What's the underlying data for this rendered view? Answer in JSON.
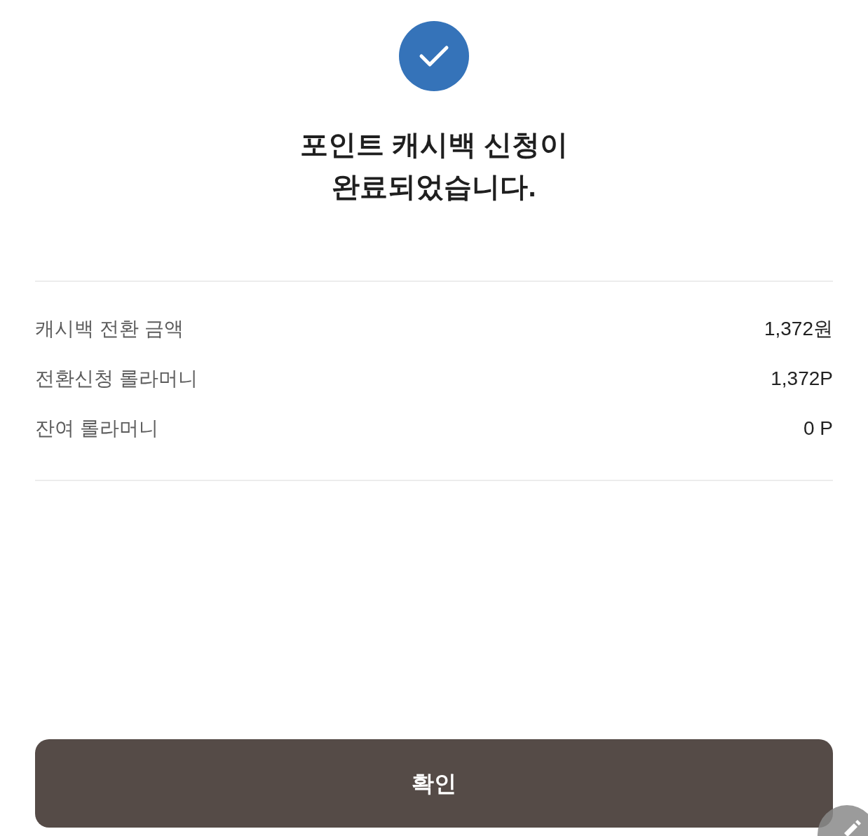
{
  "title_lines": [
    "포인트 캐시백 신청이",
    "완료되었습니다."
  ],
  "summary": [
    {
      "label": "캐시백 전환 금액",
      "value": "1,372원"
    },
    {
      "label": "전환신청 롤라머니",
      "value": "1,372P"
    },
    {
      "label": "잔여 롤라머니",
      "value": "0 P"
    }
  ],
  "confirm_button": {
    "label": "확인"
  }
}
